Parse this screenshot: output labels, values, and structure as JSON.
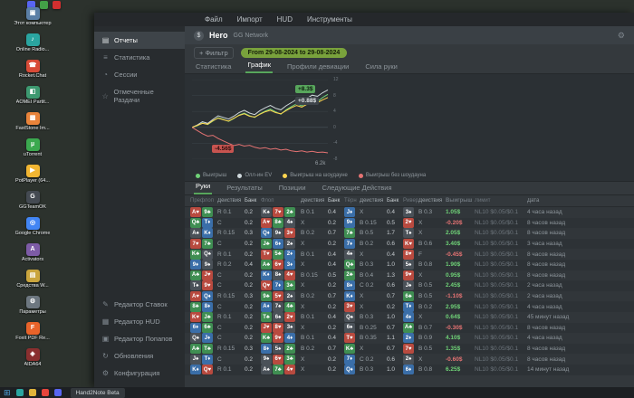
{
  "desktop": {
    "top_icons": [
      {
        "name": "discord-icon",
        "color": "#5865f2"
      },
      {
        "name": "steam-icon",
        "color": "#43a047"
      },
      {
        "name": "media-icon",
        "color": "#d32f2f"
      }
    ],
    "icons": [
      {
        "label": "Этот компьютер",
        "glyph": "▣",
        "color": "#5b7fa6"
      },
      {
        "label": "Online Radio...",
        "glyph": "♪",
        "color": "#2aa5a0"
      },
      {
        "label": "Rocket.Chat",
        "glyph": "☎",
        "color": "#d84b37"
      },
      {
        "label": "AOMEI Partit...",
        "glyph": "◧",
        "color": "#3d9970"
      },
      {
        "label": "FastStone Im...",
        "glyph": "▩",
        "color": "#e8833a"
      },
      {
        "label": "uTorrent",
        "glyph": "µ",
        "color": "#3ba94f"
      },
      {
        "label": "PotPlayer (64...",
        "glyph": "▶",
        "color": "#f2b632"
      },
      {
        "label": "GGTeamOK",
        "glyph": "G",
        "color": "#444a52"
      },
      {
        "label": "Google Chrome",
        "glyph": "◎",
        "color": "#4285f4"
      },
      {
        "label": "Activators",
        "glyph": "A",
        "color": "#7d5ba6"
      },
      {
        "label": "Средства W...",
        "glyph": "▤",
        "color": "#caa53d"
      },
      {
        "label": "Параметры",
        "glyph": "⚙",
        "color": "#6d7780"
      },
      {
        "label": "Foxit PDF Re...",
        "glyph": "F",
        "color": "#e8632a"
      },
      {
        "label": "AIDA64",
        "glyph": "◈",
        "color": "#8a2f2f"
      }
    ]
  },
  "taskbar": {
    "start_glyph": "⊞",
    "app_label": "Hand2Note Beta",
    "items": [
      {
        "name": "search-icon",
        "color": "#2aa5a0"
      },
      {
        "name": "explorer-icon",
        "color": "#e0b43a"
      },
      {
        "name": "chrome-icon",
        "color": "#e8453c"
      },
      {
        "name": "discord-icon",
        "color": "#5865f2"
      }
    ]
  },
  "app": {
    "menu": {
      "items": [
        "Файл",
        "Импорт",
        "HUD",
        "Инструменты"
      ]
    },
    "sidebar": {
      "top": [
        {
          "label": "Отчеты",
          "icon": "▤",
          "active": true
        },
        {
          "label": "Статистика",
          "icon": "≡",
          "active": false
        },
        {
          "label": "Сессии",
          "icon": "◔",
          "active": false
        },
        {
          "label": "Отмеченные Раздачи",
          "icon": "☆",
          "active": false
        }
      ],
      "bottom": [
        {
          "label": "Редактор Ставок",
          "icon": "✎",
          "active": false
        },
        {
          "label": "Редактор HUD",
          "icon": "▦",
          "active": false
        },
        {
          "label": "Редактор Попапов",
          "icon": "▣",
          "active": false
        },
        {
          "label": "Обновления",
          "icon": "↻",
          "active": false
        },
        {
          "label": "Конфигурация",
          "icon": "⚙",
          "active": false
        }
      ]
    },
    "header": {
      "currency": "$",
      "player": "Hero",
      "network": "GG Network",
      "gear": "⚙"
    },
    "filter": {
      "add": "+ Фильтр",
      "range": "From 29-08-2024 to 29-08-2024"
    },
    "report_tabs": [
      {
        "label": "Статистика",
        "active": false
      },
      {
        "label": "График",
        "active": true
      },
      {
        "label": "Профили девиации",
        "active": false
      },
      {
        "label": "Сила руки",
        "active": false
      }
    ],
    "hands_tabs": [
      {
        "label": "Руки",
        "active": true
      },
      {
        "label": "Результаты",
        "active": false
      },
      {
        "label": "Позиции",
        "active": false
      },
      {
        "label": "Следующие Действия",
        "active": false
      }
    ],
    "table": {
      "headers": [
        "Префлоп",
        "Действия",
        "Банк",
        "Флоп",
        "Действия",
        "Банк",
        "Тёрн",
        "Действия",
        "Банк",
        "Ривер",
        "Действия",
        "Выигрыш",
        "Лимит",
        "Дата"
      ],
      "rows": [
        {
          "hole": [
            "Ah",
            "9c"
          ],
          "a1": "R 0.1",
          "p1": "0.2",
          "flop": [
            "Ks",
            "7h",
            "2c"
          ],
          "a2": "B 0.1",
          "p2": "0.4",
          "turn": "Jd",
          "a3": "X",
          "p3": "0.4",
          "river": "3s",
          "a4": "B 0.3",
          "win": "1.05$",
          "neg": false,
          "stake": "NL10 $0.05/$0.1",
          "date": "4 часа назад"
        },
        {
          "hole": [
            "Qc",
            "Td"
          ],
          "a1": "C",
          "p1": "0.2",
          "flop": [
            "Ah",
            "8c",
            "4s"
          ],
          "a2": "X",
          "p2": "0.2",
          "turn": "9d",
          "a3": "B 0.15",
          "p3": "0.5",
          "river": "2h",
          "a4": "X",
          "win": "-0.20$",
          "neg": true,
          "stake": "NL10 $0.05/$0.1",
          "date": "8 часов назад"
        },
        {
          "hole": [
            "As",
            "Kd"
          ],
          "a1": "R 0.15",
          "p1": "0.3",
          "flop": [
            "Qd",
            "9s",
            "3h"
          ],
          "a2": "B 0.2",
          "p2": "0.7",
          "turn": "7c",
          "a3": "B 0.5",
          "p3": "1.7",
          "river": "Ts",
          "a4": "X",
          "win": "2.05$",
          "neg": false,
          "stake": "NL10 $0.05/$0.1",
          "date": "8 часов назад"
        },
        {
          "hole": [
            "7h",
            "7c"
          ],
          "a1": "C",
          "p1": "0.2",
          "flop": [
            "Jc",
            "6d",
            "2s"
          ],
          "a2": "X",
          "p2": "0.2",
          "turn": "7d",
          "a3": "B 0.2",
          "p3": "0.6",
          "river": "Kh",
          "a4": "B 0.6",
          "win": "3.40$",
          "neg": false,
          "stake": "NL10 $0.05/$0.1",
          "date": "3 часа назад"
        },
        {
          "hole": [
            "Kc",
            "Qs"
          ],
          "a1": "R 0.1",
          "p1": "0.2",
          "flop": [
            "Th",
            "5c",
            "2d"
          ],
          "a2": "B 0.1",
          "p2": "0.4",
          "turn": "4s",
          "a3": "X",
          "p3": "0.4",
          "river": "8h",
          "a4": "F",
          "win": "-0.45$",
          "neg": true,
          "stake": "NL10 $0.05/$0.1",
          "date": "8 часов назад"
        },
        {
          "hole": [
            "9d",
            "9s"
          ],
          "a1": "R 0.2",
          "p1": "0.4",
          "flop": [
            "Ac",
            "6h",
            "3d"
          ],
          "a2": "X",
          "p2": "0.4",
          "turn": "Qc",
          "a3": "B 0.3",
          "p3": "1.0",
          "river": "5s",
          "a4": "B 0.8",
          "win": "1.90$",
          "neg": false,
          "stake": "NL10 $0.05/$0.1",
          "date": "8 часов назад"
        },
        {
          "hole": [
            "Ac",
            "Jh"
          ],
          "a1": "C",
          "p1": "0.2",
          "flop": [
            "Kd",
            "8s",
            "4h"
          ],
          "a2": "B 0.15",
          "p2": "0.5",
          "turn": "2c",
          "a3": "B 0.4",
          "p3": "1.3",
          "river": "9h",
          "a4": "X",
          "win": "0.95$",
          "neg": false,
          "stake": "NL10 $0.05/$0.1",
          "date": "8 часов назад"
        },
        {
          "hole": [
            "Ts",
            "9h"
          ],
          "a1": "C",
          "p1": "0.2",
          "flop": [
            "Qh",
            "7d",
            "3c"
          ],
          "a2": "X",
          "p2": "0.2",
          "turn": "8d",
          "a3": "C 0.2",
          "p3": "0.6",
          "river": "Js",
          "a4": "B 0.5",
          "win": "2.45$",
          "neg": false,
          "stake": "NL10 $0.05/$0.1",
          "date": "2 часа назад"
        },
        {
          "hole": [
            "Ah",
            "Qd"
          ],
          "a1": "R 0.15",
          "p1": "0.3",
          "flop": [
            "9c",
            "5h",
            "2s"
          ],
          "a2": "B 0.2",
          "p2": "0.7",
          "turn": "Kd",
          "a3": "X",
          "p3": "0.7",
          "river": "6c",
          "a4": "B 0.5",
          "win": "-1.10$",
          "neg": true,
          "stake": "NL10 $0.05/$0.1",
          "date": "2 часа назад"
        },
        {
          "hole": [
            "8c",
            "8d"
          ],
          "a1": "C",
          "p1": "0.2",
          "flop": [
            "Ad",
            "7s",
            "4c"
          ],
          "a2": "X",
          "p2": "0.2",
          "turn": "3h",
          "a3": "X",
          "p3": "0.2",
          "river": "Td",
          "a4": "B 0.2",
          "win": "2.95$",
          "neg": false,
          "stake": "NL10 $0.05/$0.1",
          "date": "4 часа назад"
        },
        {
          "hole": [
            "Kh",
            "Jc"
          ],
          "a1": "R 0.1",
          "p1": "0.2",
          "flop": [
            "Tc",
            "6s",
            "2h"
          ],
          "a2": "B 0.1",
          "p2": "0.4",
          "turn": "Qs",
          "a3": "B 0.3",
          "p3": "1.0",
          "river": "4d",
          "a4": "X",
          "win": "0.64$",
          "neg": false,
          "stake": "NL10 $0.05/$0.1",
          "date": "45 минут назад"
        },
        {
          "hole": [
            "6d",
            "6c"
          ],
          "a1": "C",
          "p1": "0.2",
          "flop": [
            "Jh",
            "8h",
            "3s"
          ],
          "a2": "X",
          "p2": "0.2",
          "turn": "6s",
          "a3": "B 0.25",
          "p3": "0.7",
          "river": "Ac",
          "a4": "B 0.7",
          "win": "-0.30$",
          "neg": true,
          "stake": "NL10 $0.05/$0.1",
          "date": "8 часов назад"
        },
        {
          "hole": [
            "Qs",
            "Jd"
          ],
          "a1": "C",
          "p1": "0.2",
          "flop": [
            "Kc",
            "9h",
            "4d"
          ],
          "a2": "B 0.1",
          "p2": "0.4",
          "turn": "Th",
          "a3": "B 0.35",
          "p3": "1.1",
          "river": "2d",
          "a4": "B 0.9",
          "win": "4.10$",
          "neg": false,
          "stake": "NL10 $0.05/$0.1",
          "date": "4 часа назад"
        },
        {
          "hole": [
            "Ac",
            "Tc"
          ],
          "a1": "R 0.15",
          "p1": "0.3",
          "flop": [
            "8d",
            "5s",
            "2c"
          ],
          "a2": "B 0.2",
          "p2": "0.7",
          "turn": "Kc",
          "a3": "X",
          "p3": "0.7",
          "river": "7h",
          "a4": "B 0.5",
          "win": "1.35$",
          "neg": false,
          "stake": "NL10 $0.05/$0.1",
          "date": "8 часов назад"
        },
        {
          "hole": [
            "Js",
            "Td"
          ],
          "a1": "C",
          "p1": "0.2",
          "flop": [
            "9s",
            "6h",
            "3c"
          ],
          "a2": "X",
          "p2": "0.2",
          "turn": "7d",
          "a3": "C 0.2",
          "p3": "0.6",
          "river": "2s",
          "a4": "X",
          "win": "-0.60$",
          "neg": true,
          "stake": "NL10 $0.05/$0.1",
          "date": "8 часов назад"
        },
        {
          "hole": [
            "Kd",
            "Qh"
          ],
          "a1": "R 0.1",
          "p1": "0.2",
          "flop": [
            "As",
            "7c",
            "4h"
          ],
          "a2": "X",
          "p2": "0.2",
          "turn": "Qd",
          "a3": "B 0.3",
          "p3": "1.0",
          "river": "6d",
          "a4": "B 0.8",
          "win": "6.25$",
          "neg": false,
          "stake": "NL10 $0.05/$0.1",
          "date": "14 минут назад"
        }
      ]
    }
  },
  "chart_data": {
    "type": "line",
    "title": "",
    "xlabel": "",
    "ylabel": "",
    "x_max_label": "6.2k",
    "ylim": [
      -8,
      12
    ],
    "yticks": [
      12,
      8,
      4,
      0,
      -4,
      -8
    ],
    "legend_position": "bottom",
    "grid": true,
    "series": [
      {
        "name": "Выигрыш",
        "color": "#6fd177",
        "values": [
          0,
          0.4,
          1.1,
          0.7,
          1.6,
          2.4,
          2.0,
          1.5,
          2.2,
          3.1,
          3.6,
          2.9,
          2.5,
          3.4,
          4.1,
          4.6,
          3.9,
          3.3,
          4.4,
          5.2,
          5.9,
          5.4,
          6.2,
          7.0,
          6.5,
          7.5,
          8.3
        ]
      },
      {
        "name": "Олл-ин EV",
        "color": "#cfd8dc",
        "values": [
          0,
          0.6,
          1.4,
          1.0,
          2.0,
          2.9,
          2.5,
          2.1,
          2.8,
          3.7,
          4.3,
          3.6,
          3.2,
          4.2,
          4.9,
          5.5,
          4.8,
          4.4,
          5.4,
          6.2,
          7.0,
          6.6,
          7.3,
          8.1,
          7.8,
          8.7,
          9.4
        ]
      },
      {
        "name": "Выигрыш на шоудауне",
        "color": "#ffd54f",
        "values": [
          0,
          0.5,
          1.0,
          0.8,
          1.7,
          2.3,
          1.9,
          1.6,
          2.3,
          3.0,
          3.4,
          2.8,
          2.6,
          3.3,
          3.9,
          4.3,
          3.7,
          3.4,
          4.2,
          4.9,
          5.5,
          5.1,
          5.8,
          6.5,
          6.2,
          6.9,
          7.5
        ]
      },
      {
        "name": "Выигрыш без шоудауна",
        "color": "#e57373",
        "values": [
          0,
          -0.8,
          -1.6,
          -2.2,
          -2.0,
          -2.8,
          -3.4,
          -4.0,
          -4.56,
          -4.3,
          -4.7,
          -4.5,
          -5.0,
          -5.3,
          -5.1,
          -5.5,
          -5.3,
          -5.7,
          -5.5,
          -5.9,
          -6.1,
          -5.9,
          -6.2,
          -6.0,
          -6.3,
          -6.2,
          -6.4
        ]
      }
    ],
    "badges": [
      {
        "text": "+8.3$",
        "kind": "pos"
      },
      {
        "text": "+0.88$",
        "kind": "neu"
      },
      {
        "text": "-4.56$",
        "kind": "neg"
      }
    ]
  }
}
